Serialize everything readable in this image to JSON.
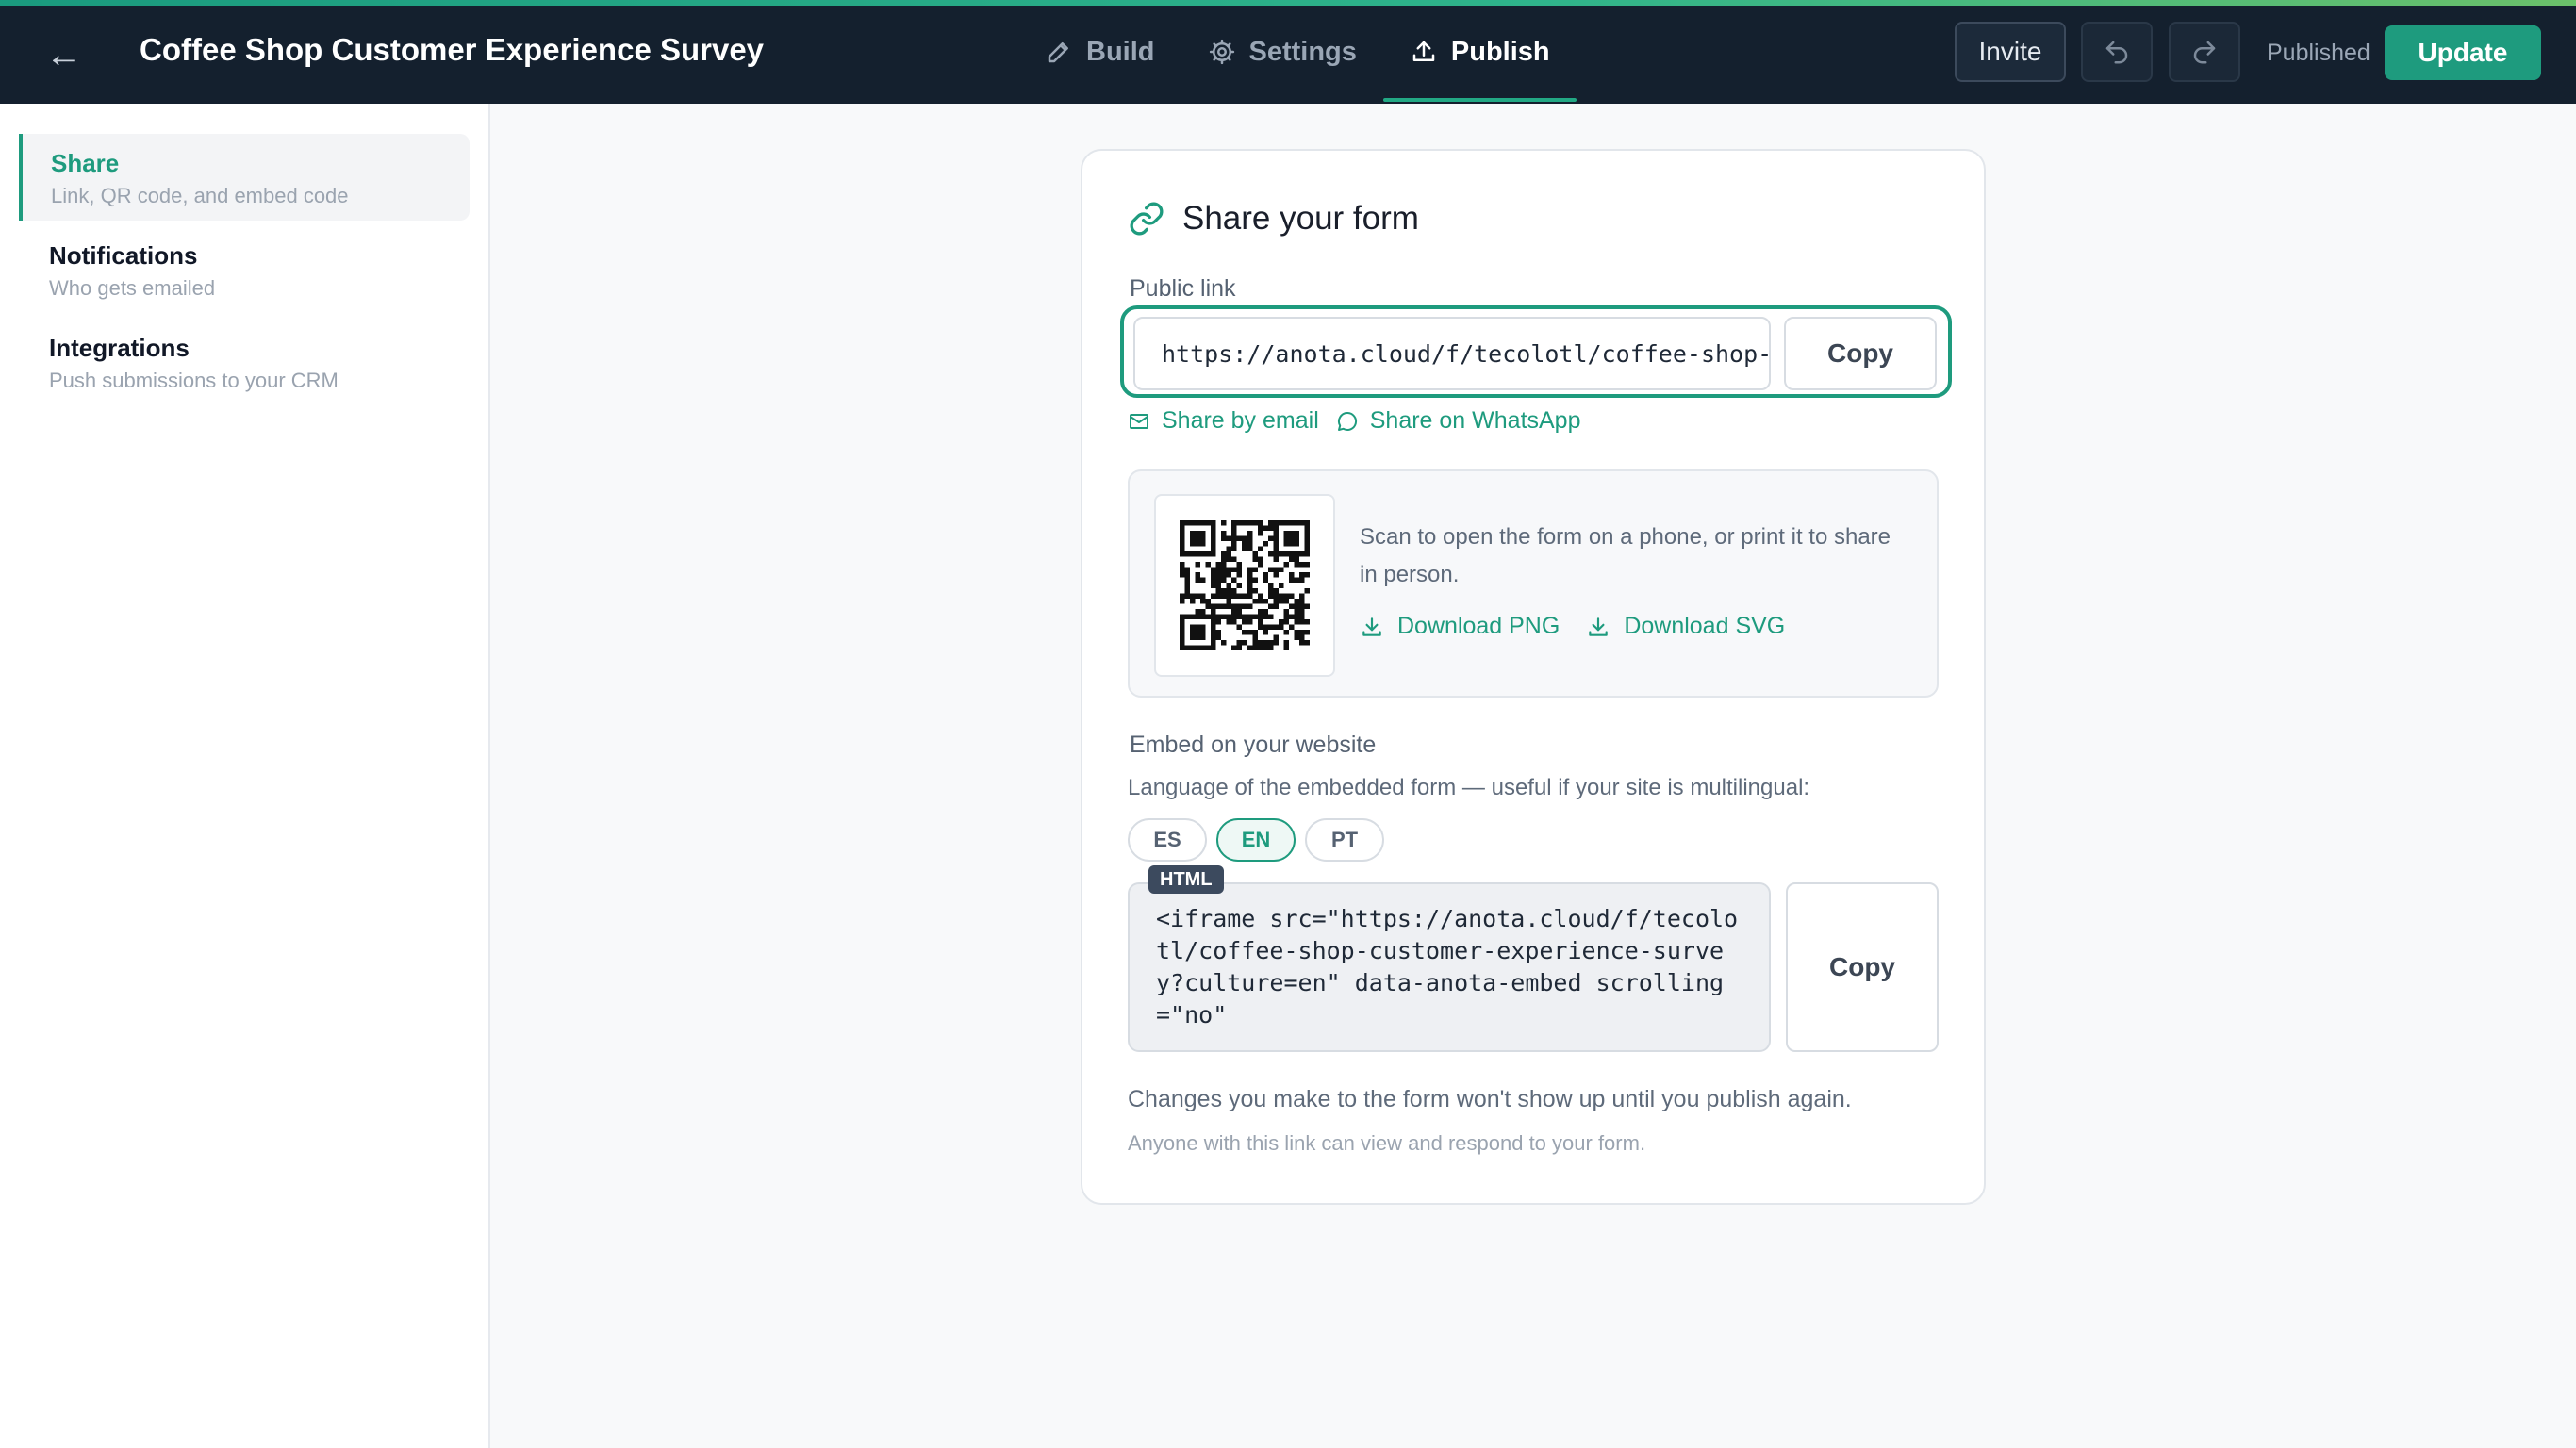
{
  "topbar": {
    "title": "Coffee Shop Customer Experience Survey",
    "tabs": [
      {
        "label": "Build",
        "icon": "pencil-icon"
      },
      {
        "label": "Settings",
        "icon": "gear-icon"
      },
      {
        "label": "Publish",
        "icon": "upload-icon",
        "active": true
      }
    ],
    "invite_label": "Invite",
    "status_label": "Published",
    "update_label": "Update"
  },
  "sidebar": {
    "items": [
      {
        "label": "Share",
        "desc": "Link, QR code, and embed code",
        "active": true
      },
      {
        "label": "Notifications",
        "desc": "Who gets emailed"
      },
      {
        "label": "Integrations",
        "desc": "Push submissions to your CRM"
      }
    ]
  },
  "share": {
    "title": "Share your form",
    "public_link_label": "Public link",
    "public_link": "https://anota.cloud/f/tecolotl/coffee-shop-customer-experience-survey",
    "copy_label": "Copy",
    "share_email_label": "Share by email",
    "share_whatsapp_label": "Share on WhatsApp",
    "qr_text": "Scan to open the form on a phone, or print it to share in person.",
    "download_png_label": "Download PNG",
    "download_svg_label": "Download SVG",
    "embed_label": "Embed on your website",
    "embed_hint": "Language of the embedded form — useful if your site is multilingual:",
    "languages": [
      "ES",
      "EN",
      "PT"
    ],
    "selected_language": "EN",
    "code_badge": "HTML",
    "embed_code": "<iframe src=\"https://anota.cloud/f/tecolotl/coffee-shop-customer-experience-survey?culture=en\" data-anota-embed scrolling=\"no\"",
    "copy_code_label": "Copy",
    "publish_note": "Changes you make to the form won't show up until you publish again.",
    "access_note": "Anyone with this link can view and respond to your form."
  },
  "colors": {
    "accent": "#1e9b7e",
    "topbar": "#14202e",
    "background": "#f8f9fa"
  }
}
